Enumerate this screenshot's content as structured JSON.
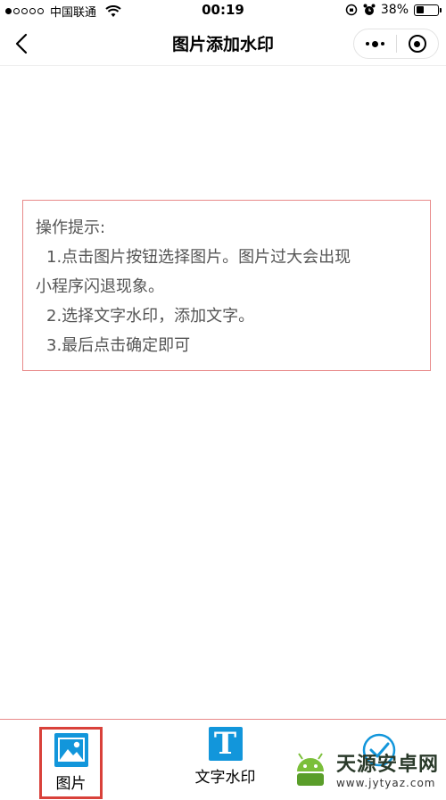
{
  "status_bar": {
    "carrier": "中国联通",
    "time": "00:19",
    "battery": "38%",
    "battery_level": 0.38
  },
  "nav": {
    "title": "图片添加水印"
  },
  "tips": {
    "heading": "操作提示:",
    "line1": "1.点击图片按钮选择图片。图片过大会出现",
    "line1_cont": "小程序闪退现象。",
    "line2": "2.选择文字水印，添加文字。",
    "line3": "3.最后点击确定即可"
  },
  "tabs": {
    "image_label": "图片",
    "text_label": "文字水印",
    "text_icon_glyph": "T"
  },
  "watermark": {
    "name": "天源安卓网",
    "url": "www.jytyaz.com"
  },
  "colors": {
    "accent_blue": "#1296db",
    "tip_border": "#e88a8a",
    "highlight_red": "#d9413a"
  }
}
